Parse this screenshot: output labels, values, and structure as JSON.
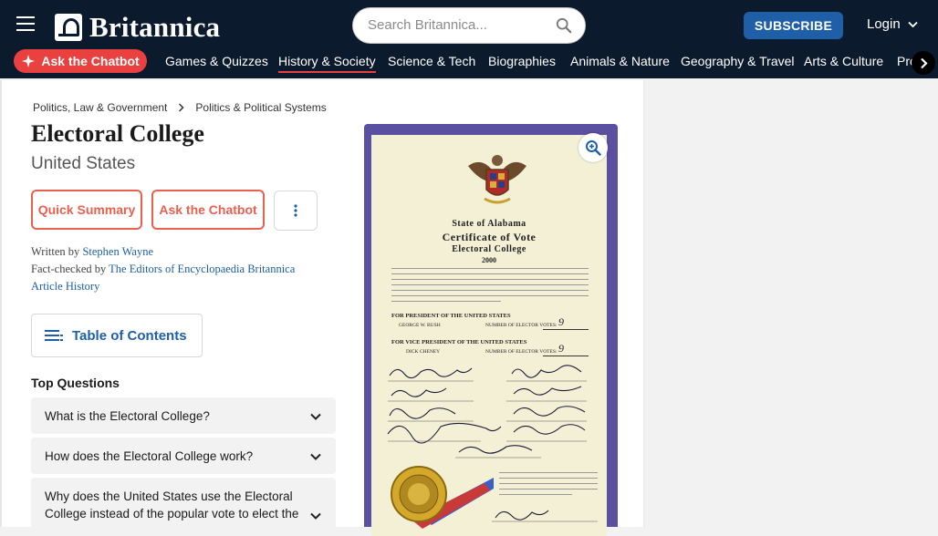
{
  "header": {
    "logo_text": "Britannica",
    "search_placeholder": "Search Britannica...",
    "subscribe_label": "SUBSCRIBE",
    "login_label": "Login"
  },
  "nav": {
    "chatbot_label": "Ask the Chatbot",
    "items": [
      "Games & Quizzes",
      "History & Society",
      "Science & Tech",
      "Biographies",
      "Animals & Nature",
      "Geography & Travel",
      "Arts & Culture",
      "Pro"
    ],
    "active_index": 1
  },
  "article": {
    "breadcrumb": [
      "Politics, Law & Government",
      "Politics & Political Systems"
    ],
    "title": "Electoral College",
    "subtitle": "United States",
    "quick_summary_label": "Quick Summary",
    "ask_chatbot_label": "Ask the Chatbot",
    "written_by_label": "Written by",
    "author": "Stephen Wayne",
    "fact_checked_label": "Fact-checked by",
    "fact_checker": "The Editors of Encyclopaedia Britannica",
    "article_history_label": "Article History",
    "toc_label": "Table of Contents",
    "top_questions_title": "Top Questions",
    "questions": [
      "What is the Electoral College?",
      "How does the Electoral College work?",
      "Why does the United States use the Electoral College instead of the popular vote to elect the"
    ]
  },
  "figure": {
    "doc_title_1": "State of Alabama",
    "doc_title_2": "Certificate of Vote",
    "doc_title_3": "Electoral College",
    "doc_year": "2000",
    "president_label": "For President of the United States",
    "president_name": "George W. Bush",
    "vp_label": "For Vice President of the United States",
    "vp_name": "Dick Cheney",
    "votes_label": "Number of Elector Votes:",
    "president_votes": "9",
    "vp_votes": "9"
  },
  "colors": {
    "header_bg": "#0c1a2e",
    "accent_red": "#e8413f",
    "link_blue": "#1e5fa8"
  }
}
